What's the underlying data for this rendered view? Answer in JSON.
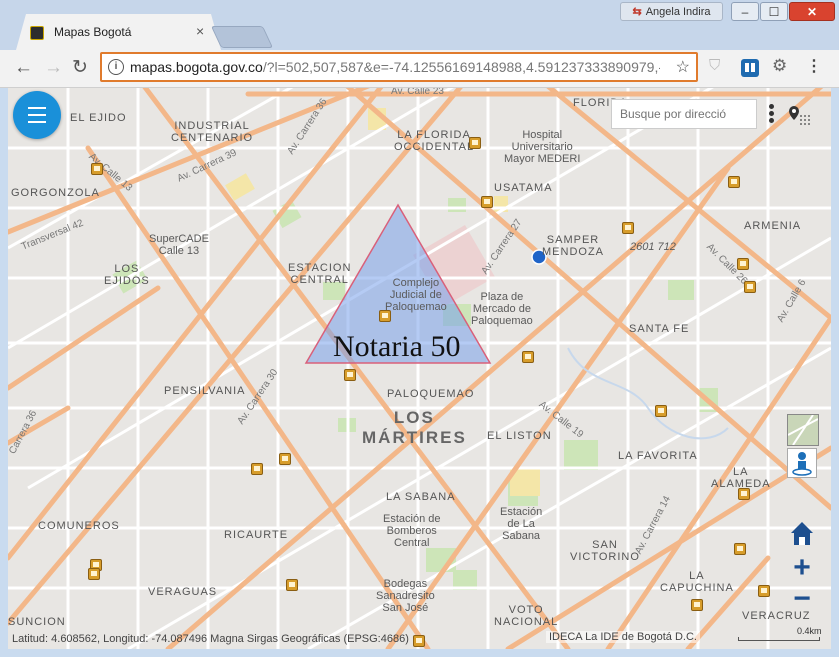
{
  "browser": {
    "tab_title": "Mapas Bogotá",
    "tab_close": "×",
    "user_name": "Angela Indira",
    "window_min": "–",
    "window_max": "☐",
    "window_close": "✕",
    "back_icon": "←",
    "forward_icon": "→",
    "reload_icon": "↻",
    "url_host": "mapas.bogota.gov.co",
    "url_rest": "/?l=502,507,587&e=-74.12556169148988,4.591237333890979,-...",
    "star_icon": "☆",
    "menu_icon": "⋮"
  },
  "map": {
    "search_placeholder": "Busque por direcció",
    "annotation_label": "Notaria 50",
    "coords_text": "Latitud: 4.608562, Longitud: -74.087496 Magna Sirgas Geográficas (EPSG:4686)",
    "attribution": "IDECA La IDE de Bogotá D.C.",
    "scale_label": "0.4km",
    "zoom_in": "+",
    "zoom_out": "−",
    "neighborhoods": [
      "EL EJIDO",
      "INDUSTRIAL\nCENTENARIO",
      "LA FLORIDA\nOCCIDENTAL",
      "FLORIDA",
      "GORGONZOLA",
      "USATAMA",
      "SAMPER\nMENDOZA",
      "ARMENIA",
      "LOS\nEJIDOS",
      "ESTACION\nCENTRAL",
      "SANTA FE",
      "PENSILVANIA",
      "PALOQUEMAO",
      "EL LISTON",
      "LA FAVORITA",
      "LA SABANA",
      "LA\nALAMEDA",
      "COMUNEROS",
      "RICAURTE",
      "SAN\nVICTORINO",
      "LA\nCAPUCHINA",
      "VERAGUAS",
      "VOTO\nNACIONAL",
      "VERACRUZ",
      "SUNCION"
    ],
    "district": "LOS\nMÁRTIRES",
    "pois": [
      "Hospital\nUniversitario\nMayor MEDERI",
      "SuperCADE\nCalle 13",
      "Complejo\nJudicial de\nPaloquemao",
      "Plaza de\nMercado de\nPaloquemao",
      "Estación de\nBomberos\nCentral",
      "Estación\nde La\nSabana",
      "Bodegas\nSanadresito\nSan José",
      "2601 712"
    ],
    "streets": [
      "Av. Calle 23",
      "Av. Carrera 39",
      "Av. Carrera 36",
      "Av. Calle 13",
      "Transversal 42",
      "Av. Carrera 27",
      "Av. Carrera 30",
      "Av. Calle 19",
      "Av. Carrera 14",
      "Av. Calle 26",
      "Av. Calle 6",
      "Carrera 36"
    ]
  }
}
